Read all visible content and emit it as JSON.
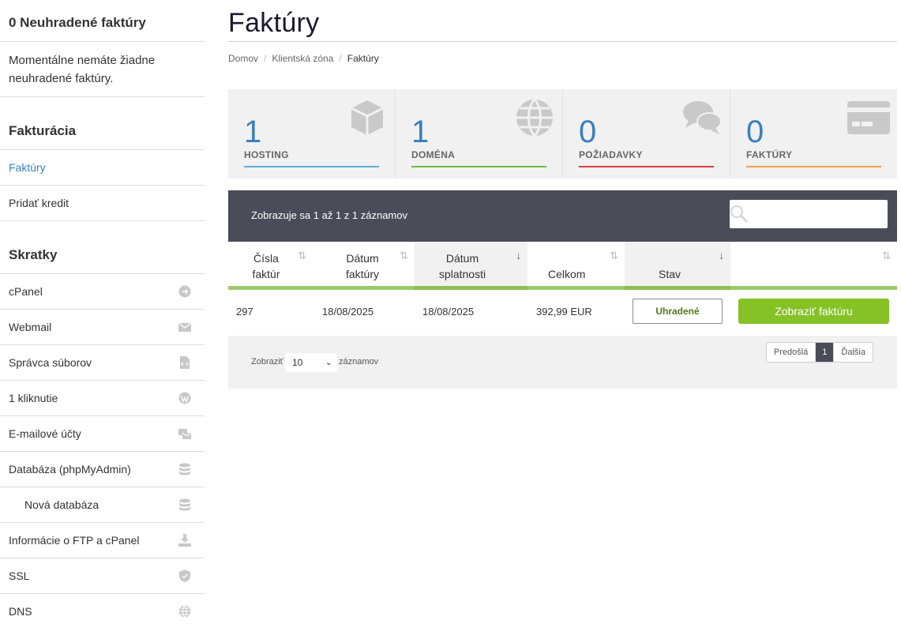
{
  "sidebar": {
    "unpaid_title": "0 Neuhradené faktúry",
    "unpaid_text": "Momentálne nemáte žiadne neuhradené faktúry.",
    "billing_title": "Fakturácia",
    "billing_items": [
      {
        "label": "Faktúry"
      },
      {
        "label": "Pridať kredit"
      }
    ],
    "shortcuts_title": "Skratky",
    "shortcuts": [
      {
        "label": "cPanel",
        "icon": "arrow-circle-right-icon"
      },
      {
        "label": "Webmail",
        "icon": "envelope-icon"
      },
      {
        "label": "Správca súborov",
        "icon": "file-code-icon"
      },
      {
        "label": "1 kliknutie",
        "icon": "wordpress-icon"
      },
      {
        "label": "E-mailové účty",
        "icon": "mail-accounts-icon"
      },
      {
        "label": "Databáza (phpMyAdmin)",
        "icon": "database-icon"
      },
      {
        "label": "Nová databáza",
        "icon": "database-icon"
      },
      {
        "label": "Informácie o FTP a cPanel",
        "icon": "download-icon"
      },
      {
        "label": "SSL",
        "icon": "shield-icon"
      },
      {
        "label": "DNS",
        "icon": "globe-icon"
      }
    ]
  },
  "page": {
    "title": "Faktúry",
    "breadcrumb": [
      "Domov",
      "Klientská zóna",
      "Faktúry"
    ]
  },
  "stats": [
    {
      "value": "1",
      "label": "HOSTING",
      "color": "#5aaee0",
      "icon": "cube-icon"
    },
    {
      "value": "1",
      "label": "DOMÉNA",
      "color": "#6dbd3a",
      "icon": "globe-icon"
    },
    {
      "value": "0",
      "label": "POŽIADAVKY",
      "color": "#d9403a",
      "icon": "comments-icon"
    },
    {
      "value": "0",
      "label": "FAKTÚRY",
      "color": "#f0a04a",
      "icon": "credit-card-icon"
    }
  ],
  "table": {
    "info": "Zobrazuje sa 1 až 1 z 1 záznamov",
    "columns": [
      "Čísla faktúr",
      "Dátum faktúry",
      "Dátum splatnosti",
      "Celkom",
      "Stav",
      ""
    ],
    "rows": [
      {
        "number": "297",
        "invoice_date": "18/08/2025",
        "due_date": "18/08/2025",
        "total": "392,99 EUR",
        "status": "Uhradené",
        "action": "Zobraziť faktúru"
      }
    ],
    "show_label": "Zobraziť",
    "show_value": "10",
    "show_suffix": "záznamov",
    "pager": {
      "prev": "Predošlá",
      "current": "1",
      "next": "Ďalšia"
    }
  }
}
